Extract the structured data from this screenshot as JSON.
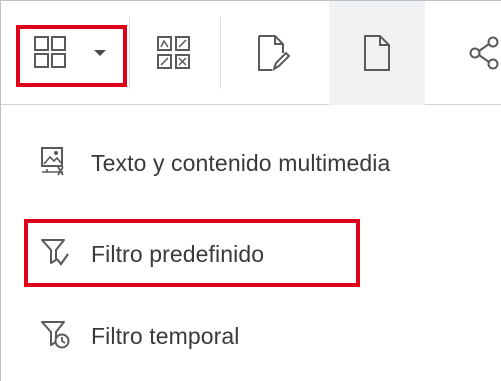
{
  "toolbar": {
    "buttons": [
      {
        "icon": "layout-grid-icon",
        "has_dropdown": true
      },
      {
        "icon": "widgets-grid-icon"
      },
      {
        "icon": "edit-page-icon"
      },
      {
        "icon": "page-icon"
      },
      {
        "icon": "share-nodes-icon"
      }
    ]
  },
  "menu": {
    "items": [
      {
        "label": "Texto y contenido multimedia",
        "icon": "image-text-icon"
      },
      {
        "label": "Filtro predefinido",
        "icon": "filter-check-icon"
      },
      {
        "label": "Filtro temporal",
        "icon": "filter-clock-icon"
      }
    ]
  },
  "colors": {
    "highlight": "#e0001b",
    "icon": "#5a5a5a",
    "text": "#3a3a3a",
    "selected_bg": "#f1f2f3"
  }
}
